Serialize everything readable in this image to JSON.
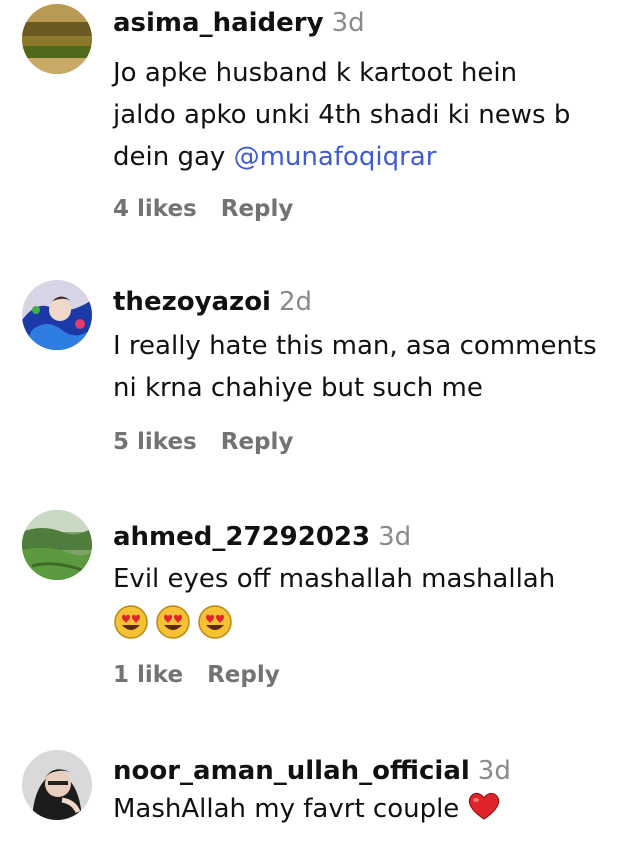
{
  "comments": [
    {
      "username": "asima_haidery",
      "time": "3d",
      "text_lines": [
        "Jo apke husband k kartoot hein",
        "jaldo apko unki 4th shadi ki news b",
        "dein gay "
      ],
      "mention": "@munafoqiqrar",
      "likes": "4 likes",
      "reply": "Reply"
    },
    {
      "username": "thezoyazoi",
      "time": "2d",
      "text_lines": [
        "I really hate this man, asa comments",
        "ni krna chahiye but such me"
      ],
      "likes": "5 likes",
      "reply": "Reply"
    },
    {
      "username": "ahmed_27292023",
      "time": "3d",
      "text_lines": [
        "Evil eyes off mashallah mashallah"
      ],
      "emojis": [
        "heart-eyes-emoji",
        "heart-eyes-emoji",
        "heart-eyes-emoji"
      ],
      "likes": "1 like",
      "reply": "Reply"
    },
    {
      "username": "noor_aman_ullah_official",
      "time": "3d",
      "text_lines": [
        "MashAllah my favrt couple"
      ],
      "emojis": [
        "red-heart-emoji"
      ]
    }
  ],
  "colors": {
    "mention": "#3f5bd6",
    "meta_gray": "#737373",
    "time_gray": "#8a8a8a",
    "heart_red": "#e0242b",
    "emoji_yellow": "#f6c134"
  }
}
